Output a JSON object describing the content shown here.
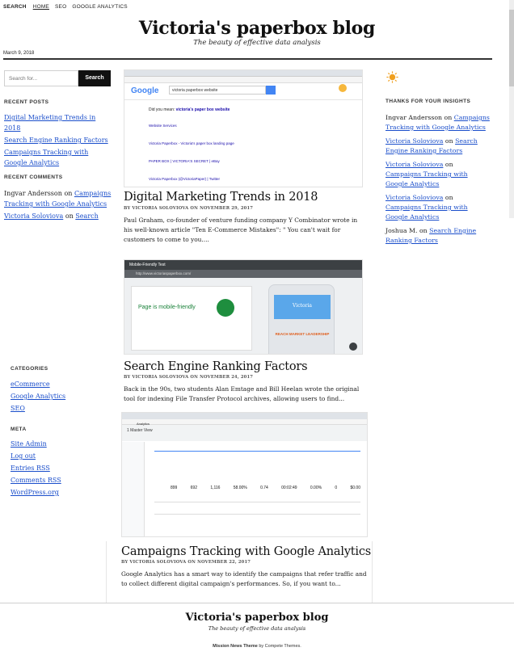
{
  "nav": {
    "search": "SEARCH",
    "links": [
      "HOME",
      "SEO",
      "GOOGLE ANALYTICS"
    ]
  },
  "header": {
    "title": "Victoria's paperbox blog",
    "tagline": "The beauty of effective data analysis",
    "date": "March 9, 2018"
  },
  "sidebar": {
    "search_placeholder": "Search for...",
    "search_button": "Search",
    "recent_posts_title": "RECENT POSTS",
    "recent_posts": [
      "Digital Marketing Trends in 2018",
      "Search Engine Ranking Factors",
      "Campaigns Tracking with Google Analytics"
    ],
    "recent_comments_title": "RECENT COMMENTS",
    "recent_comments": [
      {
        "author": "Ingvar Andersson",
        "on": "on",
        "post": "Campaigns Tracking with Google Analytics"
      },
      {
        "author": "Victoria Soloviova",
        "on": "on",
        "post": "Search"
      }
    ],
    "categories_title": "CATEGORIES",
    "categories": [
      "eCommerce",
      "Google Analytics",
      "SEO"
    ],
    "meta_title": "META",
    "meta_links": [
      "Site Admin",
      "Log out",
      "Entries RSS",
      "Comments RSS",
      "WordPress.org"
    ]
  },
  "posts": [
    {
      "title": "Digital Marketing Trends in 2018",
      "meta": "BY VICTORIA SOLOVIOVA ON NOVEMBER 29, 2017",
      "excerpt": "Paul Graham, co-founder of venture funding company Y Combinator wrote in his well-known article \"Ten E-Commerce Mistakes\": \" You can't wait for customers to come to you...."
    },
    {
      "title": "Search Engine Ranking Factors",
      "meta": "BY VICTORIA SOLOVIOVA ON NOVEMBER 24, 2017",
      "excerpt": "Back in the 90s, two students Alan Emtage and Bill Heelan wrote the original tool for indexing File Transfer Protocol archives, allowing users to find..."
    },
    {
      "title": "Campaigns Tracking with Google Analytics",
      "meta": "BY VICTORIA SOLOVIOVA ON NOVEMBER 22, 2017",
      "excerpt": "Google Analytics has a smart way to identify the campaigns that refer traffic and to collect different digital campaign's performances. So, if you want to..."
    }
  ],
  "thumb1": {
    "google_logo": "Google",
    "query": "victoria paperbox website",
    "dym_prefix": "Did you mean:",
    "dym_query": "victoria's paper box website",
    "results": [
      "Website Services",
      "Victoria Paperbox - Victoria's paper box landing page",
      "PAPER BOX | VICTORIA'S SECRET | eBay",
      "Victoria Paperbox (@VictoriaPaper) | Twitter"
    ]
  },
  "thumb2": {
    "header": "Mobile-Friendly Test",
    "url": "http://www.victoriaspaperbox.com/",
    "verdict": "Page is mobile-friendly",
    "phone_title": "Victoria",
    "phone_banner": "REACH MARKET LEADERSHIP"
  },
  "thumb3": {
    "tab": "Analytics",
    "view": "1 Master View",
    "total_values": [
      "899",
      "692",
      "1,116",
      "58.00%",
      "0.74",
      "00:02:49",
      "0.00%",
      "0",
      "$0.00"
    ]
  },
  "right": {
    "title": "THANKS FOR YOUR INSIGHTS",
    "items": [
      {
        "author": "Ingvar Andersson",
        "author_link": false,
        "on": "on",
        "post": "Campaigns Tracking with Google Analytics"
      },
      {
        "author": "Victoria Soloviova",
        "author_link": true,
        "on": "on",
        "post": "Search Engine Ranking Factors"
      },
      {
        "author": "Victoria Soloviova",
        "author_link": true,
        "on": "on",
        "post": "Campaigns Tracking with Google Analytics"
      },
      {
        "author": "Victoria Soloviova",
        "author_link": true,
        "on": "on",
        "post": "Campaigns Tracking with Google Analytics"
      },
      {
        "author": "Joshua M.",
        "author_link": false,
        "on": "on",
        "post": "Search Engine Ranking Factors"
      }
    ]
  },
  "footer": {
    "title": "Victoria's paperbox blog",
    "tagline": "The beauty of effective data analysis",
    "credit_theme": "Mission News Theme",
    "credit_by": "by Compete Themes."
  },
  "colors": {
    "link": "#1a4ecb",
    "accent_orange": "#f0a020"
  }
}
